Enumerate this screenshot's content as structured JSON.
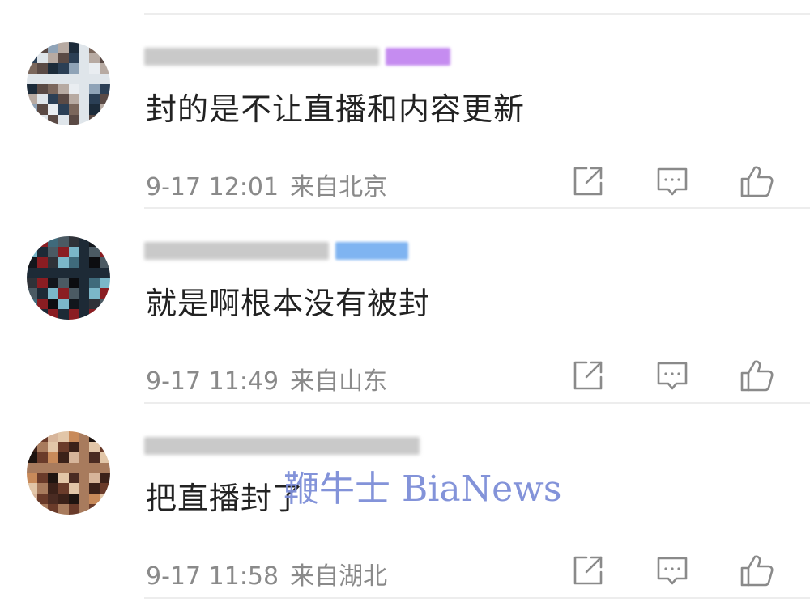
{
  "comments": [
    {
      "text": "封的是不让直播和内容更新",
      "time": "9-17 12:01",
      "location": "来自北京",
      "badge_color": "#c58cf0",
      "avatar_colors": [
        "#e9edf1",
        "#dfe5ea",
        "#8fa3b7",
        "#2b3f55",
        "#1c2b3a",
        "#5a4a45",
        "#7b675c",
        "#b7aaa2"
      ]
    },
    {
      "text": "就是啊根本没有被封",
      "time": "9-17 11:49",
      "location": "来自山东",
      "badge_color": "#7fb4f1",
      "avatar_colors": [
        "#0c0d10",
        "#1d2a36",
        "#3f6a7b",
        "#7bb7c9",
        "#2f3238",
        "#8a1d22",
        "#12161c",
        "#4b5a63"
      ]
    },
    {
      "text": "把直播封了",
      "time": "9-17 11:58",
      "location": "来自湖北",
      "badge_color": "",
      "avatar_colors": [
        "#4a2b22",
        "#a87b5d",
        "#d7b59a",
        "#3b2119",
        "#c88a5a",
        "#6a3b2a",
        "#1e1410",
        "#e2c6a8"
      ]
    }
  ],
  "icons": {
    "share": "share-icon",
    "reply": "comment-icon",
    "like": "thumbs-up-icon"
  },
  "watermark": "鞭牛士 BiaNews"
}
